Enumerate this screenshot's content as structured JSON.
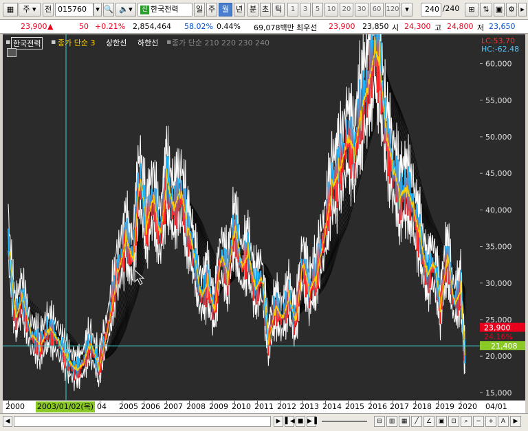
{
  "toolbar": {
    "period_type": "주",
    "jeon_label": "전",
    "code": "015760",
    "name_badge": "신",
    "name": "한국전력",
    "periods": [
      "일",
      "주",
      "월",
      "년"
    ],
    "selected_period": "월",
    "intervals": [
      "분",
      "초",
      "틱"
    ],
    "numbers": [
      "1",
      "3",
      "5",
      "10",
      "20",
      "30",
      "60",
      "120"
    ],
    "count": "240",
    "total": "/240"
  },
  "info": {
    "price": "23,900",
    "arrow": "▲",
    "change": "50",
    "rate": "+0.21%",
    "volume": "2,854,464",
    "pct1": "58.02%",
    "pct2": "0.44%",
    "amount": "69,078백만",
    "pref_label": "최우선",
    "pref_price": "23,900",
    "pref_price2": "23,850",
    "open_label": "시",
    "open": "24,300",
    "high_label": "고",
    "high": "24,800",
    "low_label": "저",
    "low": "23,650"
  },
  "legend": {
    "name": "한국전력",
    "close_ma": "종가 단순 3",
    "upper": "상한선",
    "lower": "하한선",
    "ma_multi": "종가 단순 210  220  230  240",
    "lc": "LC:53.70",
    "hc": "HC:-62.48"
  },
  "axis": {
    "ticks": [
      "60,000",
      "55,000",
      "50,000",
      "45,000",
      "40,000",
      "35,000",
      "30,000",
      "25,000",
      "20,000",
      "15,000"
    ],
    "current_price": "23,900",
    "current_pct": "24.16%",
    "crosshair_price": "21,408"
  },
  "xaxis": {
    "years": [
      "2000",
      "04",
      "2005",
      "2006",
      "2007",
      "2008",
      "2009",
      "2010",
      "2011",
      "2012",
      "2013",
      "2014",
      "2015",
      "2016",
      "2017",
      "2018",
      "2019",
      "2020"
    ],
    "cursor_date": "2003/01/02(목)",
    "right_label": "04/01"
  },
  "colors": {
    "up": "#ff2020",
    "close_ma": "#ffd000",
    "band": "#ffffff",
    "lower": "#1fb8ff",
    "cross": "#3fd0d0",
    "accent": "#4a7fd0"
  },
  "chart_data": {
    "type": "line",
    "title": "한국전력",
    "x_range": [
      2000,
      2020.3
    ],
    "ylim": [
      14000,
      64000
    ],
    "series": [
      {
        "name": "한국전력",
        "x": [
          2000,
          2000.3,
          2000.6,
          2001,
          2001.4,
          2001.8,
          2002.2,
          2002.6,
          2003,
          2003.3,
          2003.6,
          2004,
          2004.4,
          2004.8,
          2005.2,
          2005.5,
          2005.8,
          2006.1,
          2006.4,
          2006.7,
          2007,
          2007.3,
          2007.6,
          2007.9,
          2008.2,
          2008.5,
          2008.8,
          2009.1,
          2009.4,
          2009.7,
          2010,
          2010.3,
          2010.6,
          2010.9,
          2011.2,
          2011.5,
          2011.8,
          2012.1,
          2012.4,
          2012.7,
          2013,
          2013.3,
          2013.6,
          2014,
          2014.3,
          2014.6,
          2015,
          2015.3,
          2015.6,
          2015.9,
          2016.2,
          2016.4,
          2016.7,
          2017,
          2017.3,
          2017.6,
          2017.9,
          2018.2,
          2018.5,
          2018.8,
          2019.1,
          2019.4,
          2019.7,
          2020,
          2020.2
        ],
        "values": [
          36000,
          25000,
          28000,
          23000,
          21500,
          24000,
          22000,
          19500,
          18000,
          19000,
          22000,
          18500,
          24000,
          31000,
          36000,
          33000,
          45000,
          38000,
          42000,
          36000,
          44000,
          40000,
          43000,
          38000,
          34000,
          28000,
          30000,
          26000,
          34000,
          31000,
          38000,
          32000,
          34000,
          29000,
          31000,
          22000,
          27000,
          25000,
          28000,
          24500,
          33000,
          29000,
          31000,
          37000,
          43000,
          45000,
          50000,
          48000,
          54000,
          57000,
          62000,
          60000,
          50000,
          46000,
          42000,
          43000,
          40000,
          36000,
          31000,
          33000,
          27000,
          34000,
          27000,
          29000,
          19000
        ]
      }
    ],
    "ylabel": ""
  }
}
